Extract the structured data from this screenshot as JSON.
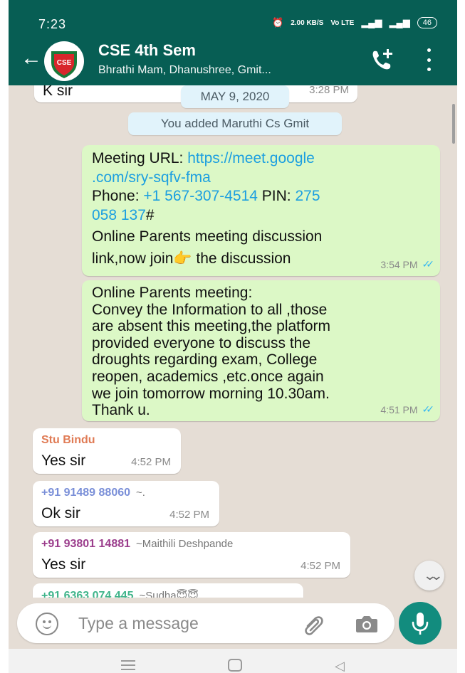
{
  "status_bar": {
    "time": "7:23",
    "alarm_icon": "alarm-icon",
    "speed": "2.00 KB/S",
    "volte": "Vo LTE",
    "signal": "⁴ᴳ",
    "battery": "46"
  },
  "header": {
    "title": "CSE 4th Sem",
    "subtitle": "Bhrathi Mam, Dhanushree, Gmit...",
    "avatar_text": "CSE",
    "back_icon": "arrow-left-icon",
    "call_icon": "add-call-icon",
    "menu_icon": "more-vertical-icon"
  },
  "chat": {
    "top_partial": {
      "text": "K sir",
      "time": "3:28 PM"
    },
    "date_chip": "MAY 9, 2020",
    "system_msg": "You added Maruthi Cs Gmit",
    "messages": [
      {
        "meeting_label": "Meeting URL: ",
        "meeting_link_1": "https://meet.google",
        "meeting_link_2": ".com/sry-sqfv-fma",
        "phone_label": "Phone: ",
        "phone_link": "+1 567-307-4514",
        "pin_label": " PIN: ",
        "pin_link_1": "275",
        "pin_link_2": "058 137",
        "pin_suffix": "#",
        "line_a": "Online Parents meeting discussion",
        "line_b_pre": "link,now join",
        "line_b_emoji": "👉",
        "line_b_post": " the discussion",
        "time": "3:54 PM"
      },
      {
        "lines": [
          "Online Parents meeting:",
          "Convey the  Information to all ,those",
          "are absent this meeting,the platform",
          "provided everyone to discuss the",
          "droughts regarding exam, College",
          "reopen, academics ,etc.once again",
          "we join tomorrow morning 10.30am.",
          "Thank u."
        ],
        "time": "4:51 PM"
      },
      {
        "sender": "Stu Bindu",
        "text": "Yes sir",
        "time": "4:52 PM"
      },
      {
        "sender": "+91 91489 88060",
        "alias": "~.",
        "text": "Ok sir",
        "time": "4:52 PM"
      },
      {
        "sender": "+91 93801 14881",
        "alias": "~Maithili Deshpande",
        "text": "Yes sir",
        "time": "4:52 PM"
      },
      {
        "sender": "+91 6363 074 445",
        "alias": "~Sudha😇😇"
      }
    ],
    "ticks": "✓✓",
    "scroll_down": "⌄⌄"
  },
  "input": {
    "placeholder": "Type a message",
    "emoji_icon": "emoji-icon",
    "attach_icon": "paperclip-icon",
    "camera_icon": "camera-icon",
    "mic_icon": "microphone-icon"
  },
  "nav": {
    "back": "◁"
  },
  "colors": {
    "header": "#075e54",
    "chat_bg": "#e5ddd5",
    "outgoing": "#dcf8c6",
    "incoming": "#ffffff",
    "link": "#1c9fe0",
    "mic": "#128c7e",
    "sender_1": "#e07b55",
    "sender_2": "#7a8fd8",
    "sender_3": "#9b3d8c",
    "sender_4": "#3fb48a"
  }
}
